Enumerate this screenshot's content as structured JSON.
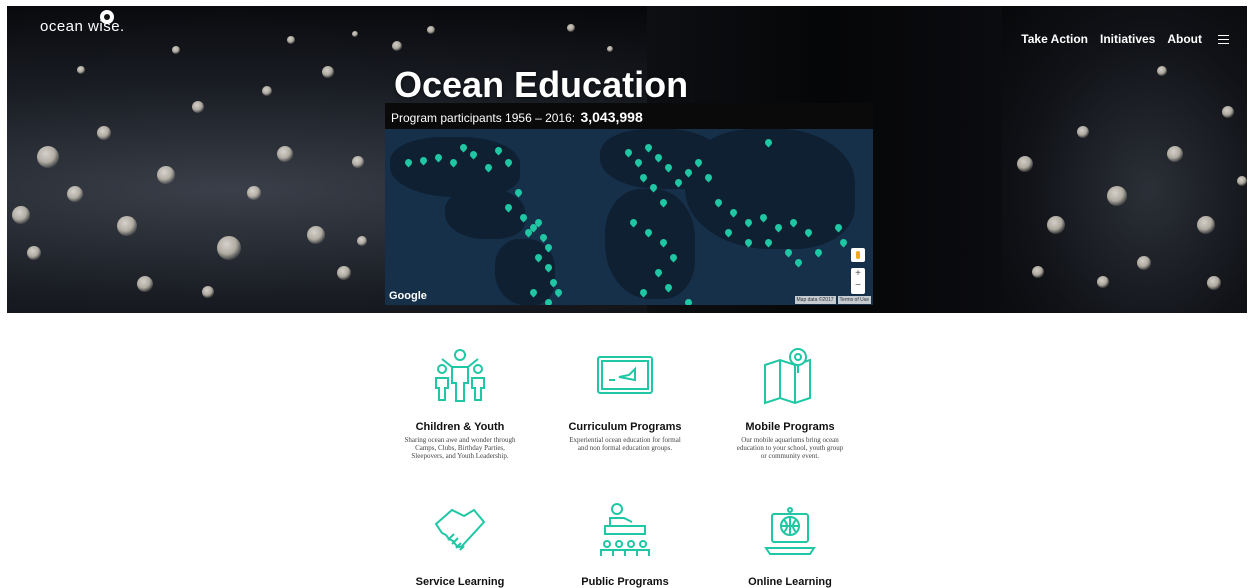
{
  "brand": {
    "name": "ocean wise."
  },
  "nav": {
    "items": [
      "Take Action",
      "Initiatives",
      "About"
    ]
  },
  "hero": {
    "title": "Ocean Education"
  },
  "map": {
    "header_label": "Program participants 1956 – 2016:",
    "header_value": "3,043,998",
    "provider": "Google",
    "attribution": [
      "Map data ©2017",
      "Terms of Use"
    ],
    "zoom_in": "+",
    "zoom_out": "−"
  },
  "programs": [
    {
      "title": "Children & Youth",
      "desc": "Sharing ocean awe and wonder through Camps, Clubs, Birthday Parties, Sleepovers, and Youth Leadership.",
      "icon": "family-icon"
    },
    {
      "title": "Curriculum Programs",
      "desc": "Experiential ocean education for formal and non formal education groups.",
      "icon": "chalkboard-icon"
    },
    {
      "title": "Mobile Programs",
      "desc": "Our mobile aquariums bring ocean education to your school, youth group or community event.",
      "icon": "map-pin-icon"
    },
    {
      "title": "Service Learning",
      "desc": "",
      "icon": "handshake-icon"
    },
    {
      "title": "Public Programs",
      "desc": "",
      "icon": "presenter-icon"
    },
    {
      "title": "Online Learning",
      "desc": "",
      "icon": "laptop-globe-icon"
    }
  ],
  "colors": {
    "accent": "#1fc7a4",
    "map_pin": "#1fc7a4",
    "hero_bg": "#0a0b0e"
  }
}
